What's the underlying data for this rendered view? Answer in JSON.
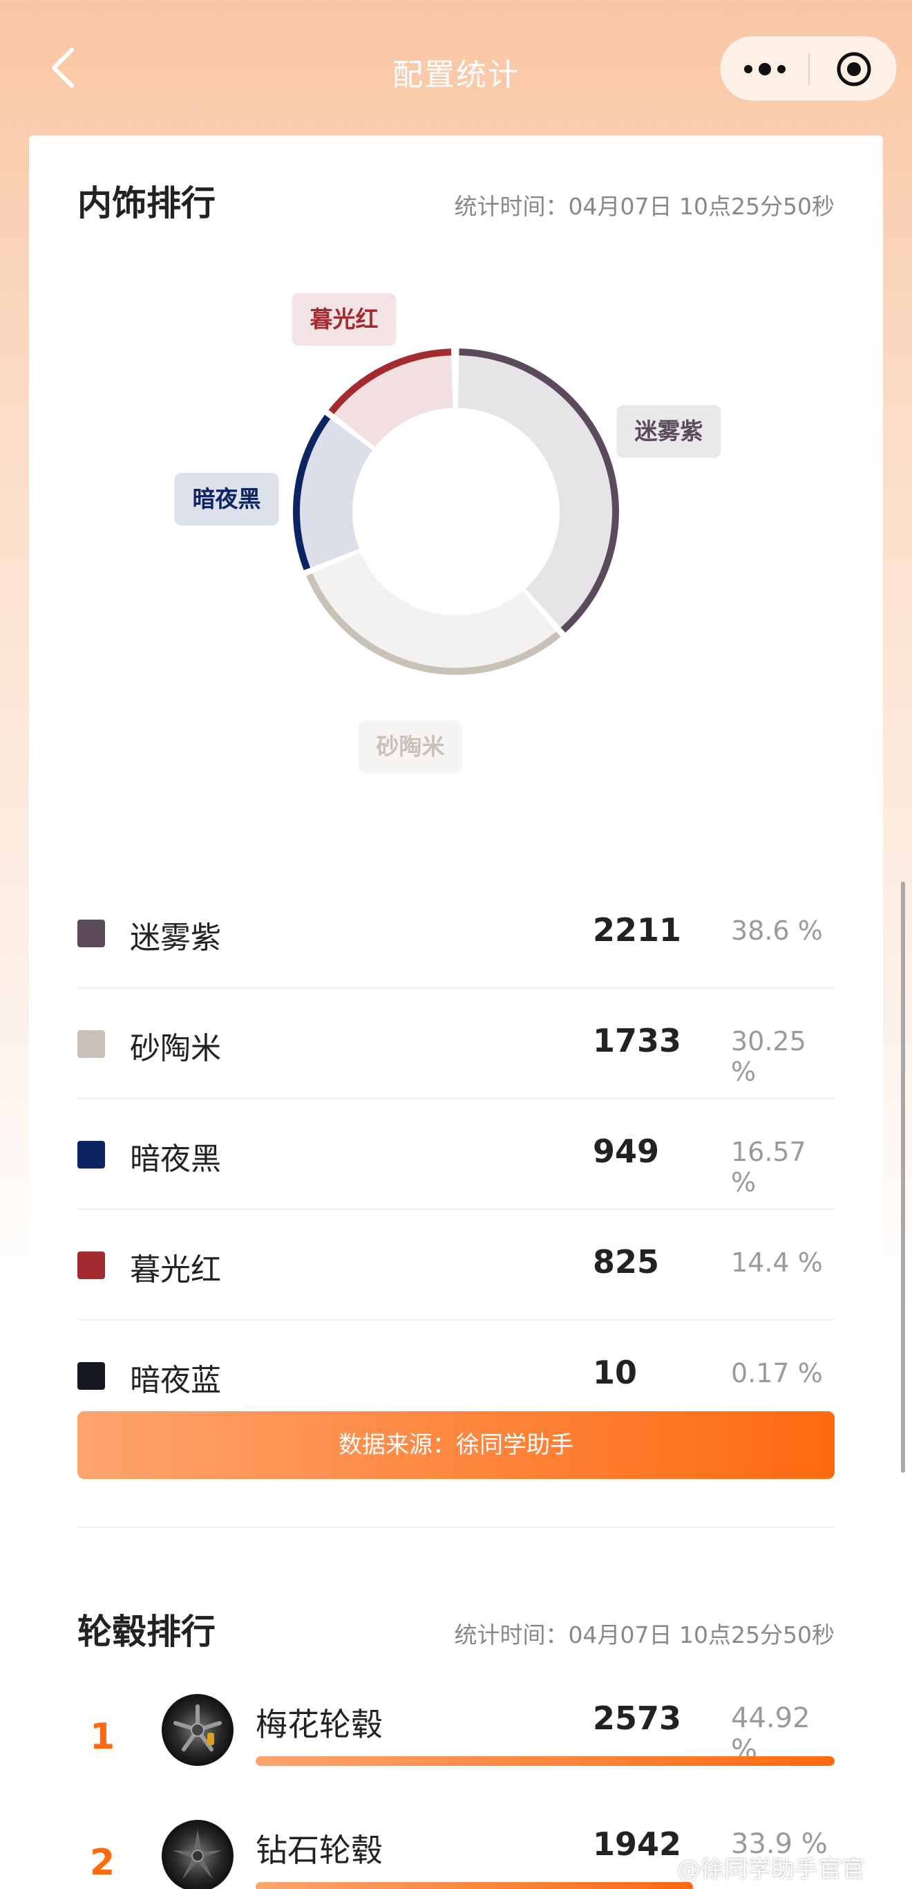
{
  "nav": {
    "title": "配置统计",
    "back_icon": "chevron-left-icon",
    "more_icon": "more-dots-icon",
    "close_icon": "target-close-icon"
  },
  "interior": {
    "title": "内饰排行",
    "time": "统计时间：04月07日 10点25分50秒",
    "source_label": "数据来源：徐同学助手",
    "items": [
      {
        "name": "迷雾紫",
        "count": "2211",
        "percent": "38.6 %",
        "color": "#5b4a5b",
        "light": "#e7e4e7"
      },
      {
        "name": "砂陶米",
        "count": "1733",
        "percent": "30.25 %",
        "color": "#c9c0b8",
        "light": "#f3f2f1"
      },
      {
        "name": "暗夜黑",
        "count": "949",
        "percent": "16.57 %",
        "color": "#0d2463",
        "light": "#dcdfe9"
      },
      {
        "name": "暮光红",
        "count": "825",
        "percent": "14.4 %",
        "color": "#a32b30",
        "light": "#f2dfe0"
      },
      {
        "name": "暗夜蓝",
        "count": "10",
        "percent": "0.17 %",
        "color": "#151820",
        "light": "#e0e0e2"
      }
    ]
  },
  "chart_data": {
    "type": "pie",
    "donut": true,
    "categories": [
      "迷雾紫",
      "砂陶米",
      "暗夜黑",
      "暮光红",
      "暗夜蓝"
    ],
    "values": [
      2211,
      1733,
      949,
      825,
      10
    ],
    "percent": [
      38.6,
      30.25,
      16.57,
      14.4,
      0.17
    ],
    "colors": [
      "#5b4a5b",
      "#c9c0b8",
      "#0d2463",
      "#a32b30",
      "#151820"
    ]
  },
  "wheels": {
    "title": "轮毂排行",
    "time": "统计时间：04月07日 10点25分50秒",
    "items": [
      {
        "rank": "1",
        "name": "梅花轮毂",
        "count": "2573",
        "percent": "44.92 %",
        "fill": 1.0,
        "icon": "wheel-icon"
      },
      {
        "rank": "2",
        "name": "钻石轮毂",
        "count": "1942",
        "percent": "33.9 %",
        "fill": 0.755,
        "icon": "wheel-icon"
      }
    ]
  },
  "watermark": "@徐同学助手官官"
}
